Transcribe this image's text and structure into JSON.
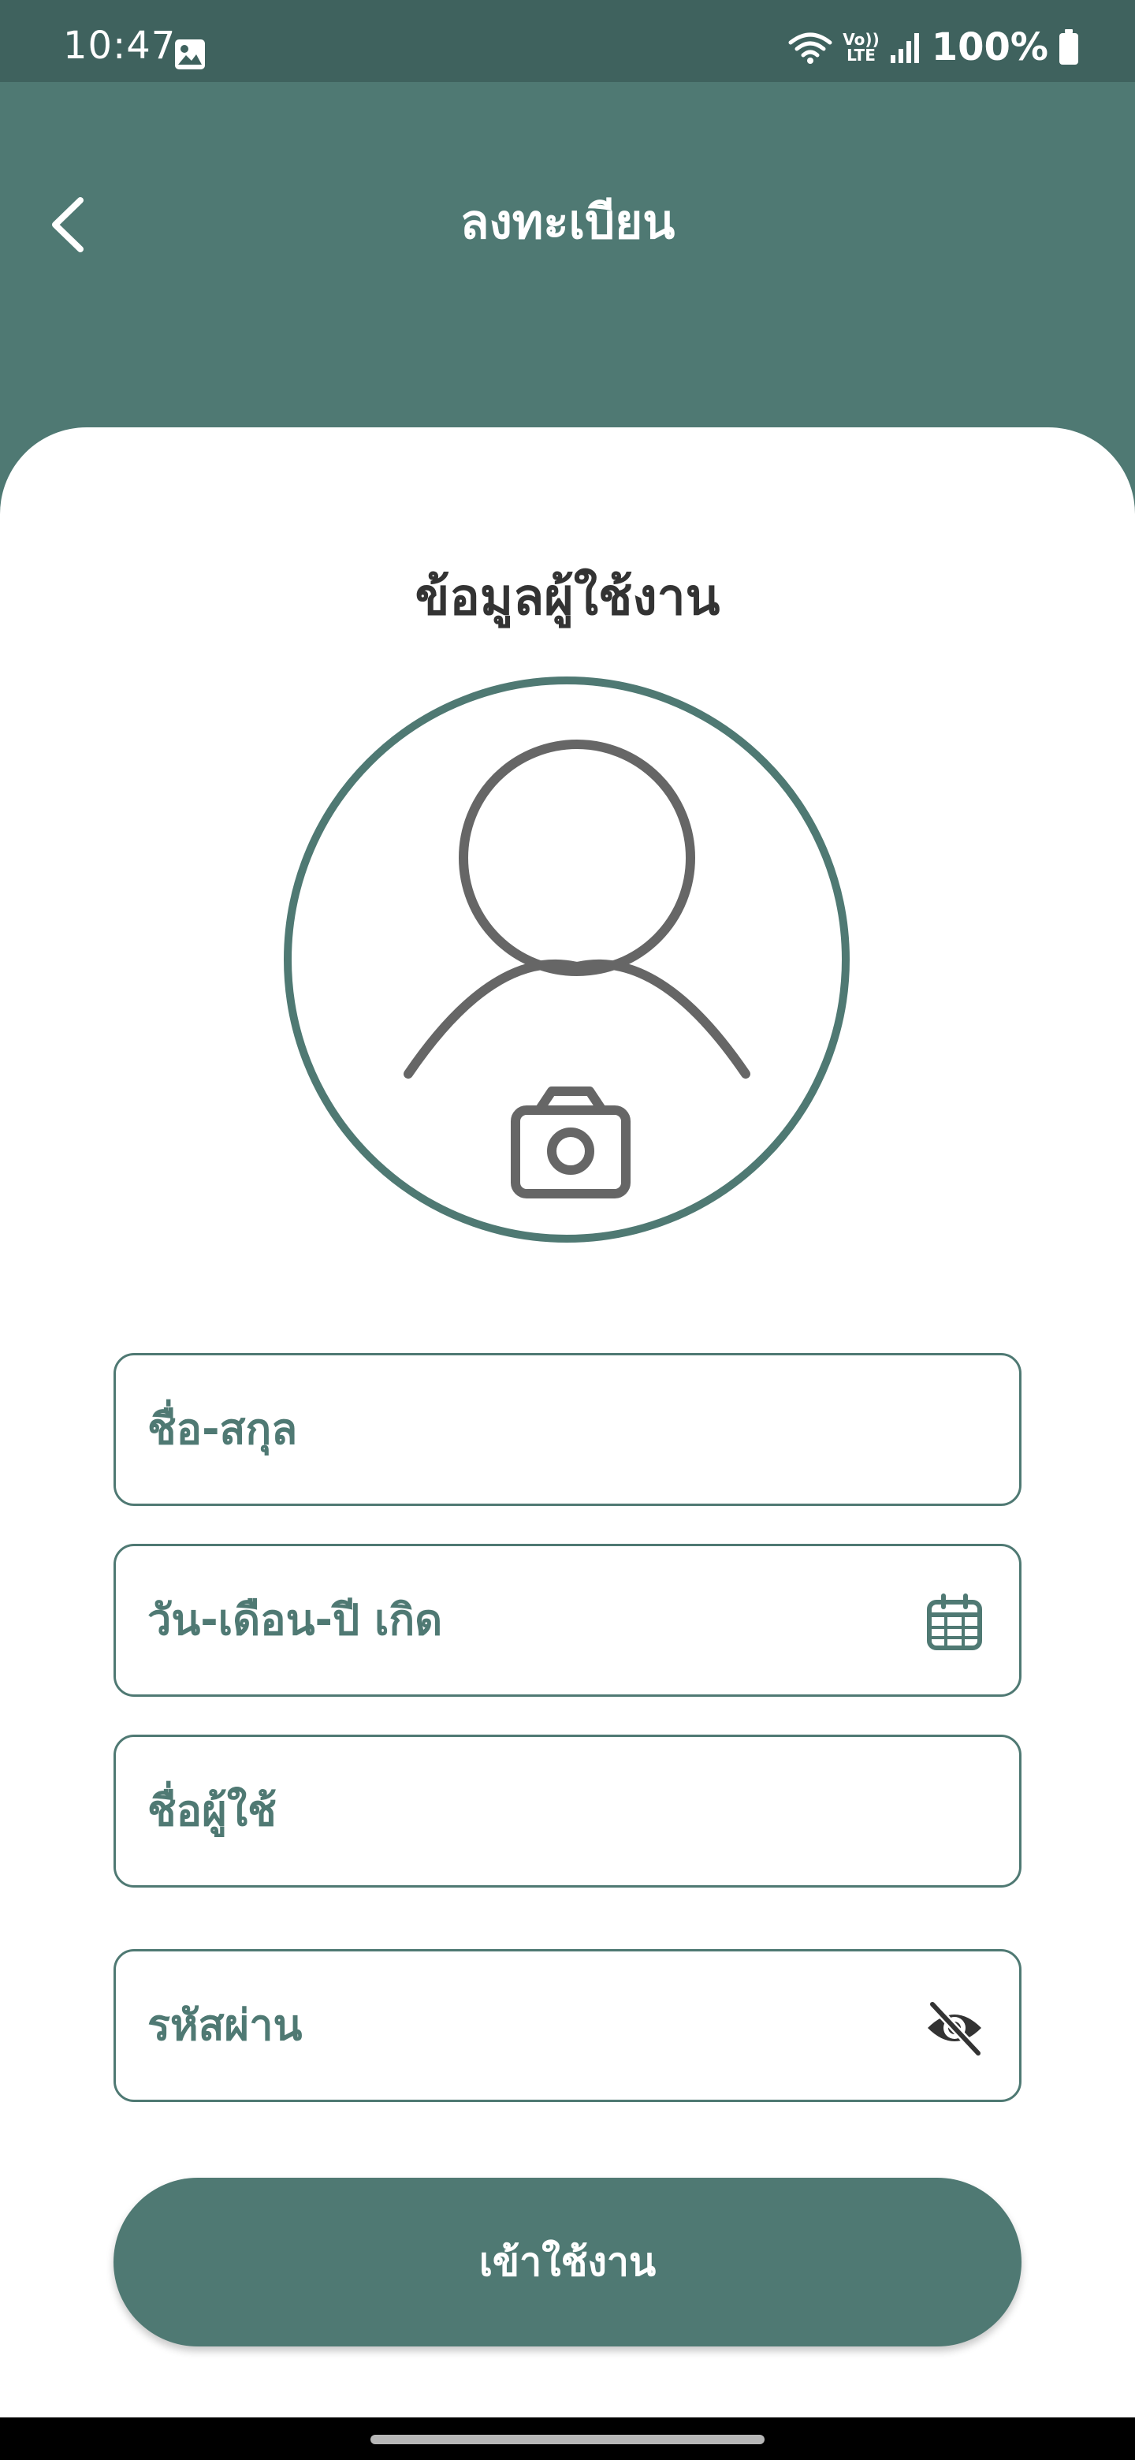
{
  "status_bar": {
    "time": "10:47",
    "network_label_top": "Vo))",
    "network_label_bottom": "LTE",
    "battery": "100%"
  },
  "header": {
    "title": "ลงทะเบียน"
  },
  "form": {
    "section_title": "ข้อมูลผู้ใช้งาน",
    "fullname_label": "ชื่อ-สกุล",
    "birthdate_label": "วัน-เดือน-ปี เกิด",
    "username_label": "ชื่อผู้ใช้",
    "password_label": "รหัสผ่าน",
    "submit_label": "เข้าใช้งาน"
  },
  "icons": {
    "back": "chevron-left-icon",
    "avatar": "person-icon",
    "camera": "camera-icon",
    "calendar": "calendar-icon",
    "password_toggle": "eye-off-icon"
  },
  "colors": {
    "primary": "#4f7973",
    "status_bar": "#3f625e",
    "title_text": "#333333",
    "icon_gray": "#666666"
  }
}
